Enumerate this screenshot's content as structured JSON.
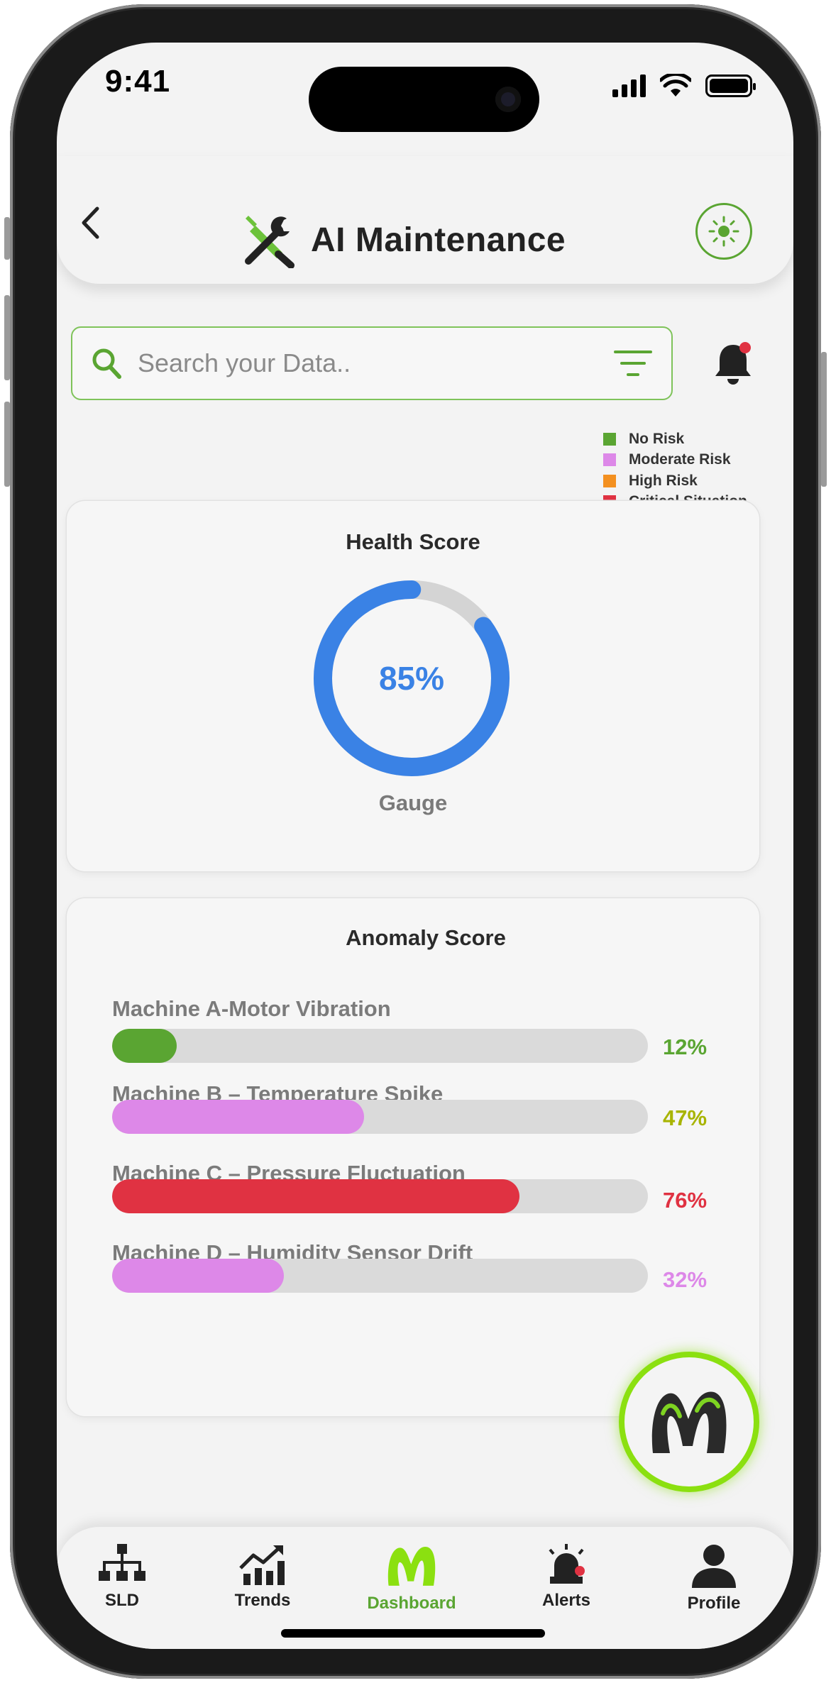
{
  "status_bar": {
    "time": "9:41"
  },
  "header": {
    "title": "AI Maintenance"
  },
  "search": {
    "placeholder": "Search your Data..",
    "value": ""
  },
  "legend": [
    {
      "label": "No Risk",
      "color": "#5aa532"
    },
    {
      "label": "Moderate Risk",
      "color": "#dd88e8"
    },
    {
      "label": "High Risk",
      "color": "#f39020"
    },
    {
      "label": "Critical Situation",
      "color": "#e03242"
    }
  ],
  "health_card": {
    "title": "Health Score",
    "gauge_value": 85,
    "gauge_text": "85%",
    "caption": "Gauge",
    "colors": {
      "fill": "#3a82e5",
      "track": "#d4d4d4"
    }
  },
  "anomaly_card": {
    "title": "Anomaly Score",
    "rows": [
      {
        "label": "Machine A-Motor Vibration",
        "value": 12,
        "value_text": "12%",
        "bar_color": "#5aa532",
        "text_color": "#5aa532"
      },
      {
        "label": "Machine B – Temperature Spike",
        "value": 47,
        "value_text": "47%",
        "bar_color": "#dd88e8",
        "text_color": "#a8b400"
      },
      {
        "label": "Machine C – Pressure Fluctuation",
        "value": 76,
        "value_text": "76%",
        "bar_color": "#e03242",
        "text_color": "#e03242"
      },
      {
        "label": "Machine D – Humidity Sensor Drift",
        "value": 32,
        "value_text": "32%",
        "bar_color": "#dd88e8",
        "text_color": "#dd88e8"
      }
    ]
  },
  "bottom_nav": {
    "items": [
      {
        "label": "SLD",
        "icon": "hierarchy-icon"
      },
      {
        "label": "Trends",
        "icon": "trends-chart-icon"
      },
      {
        "label": "Dashboard",
        "icon": "m-logo-icon",
        "active": true
      },
      {
        "label": "Alerts",
        "icon": "alarm-siren-icon"
      },
      {
        "label": "Profile",
        "icon": "profile-icon"
      }
    ]
  },
  "accent_color": "#5aa532"
}
